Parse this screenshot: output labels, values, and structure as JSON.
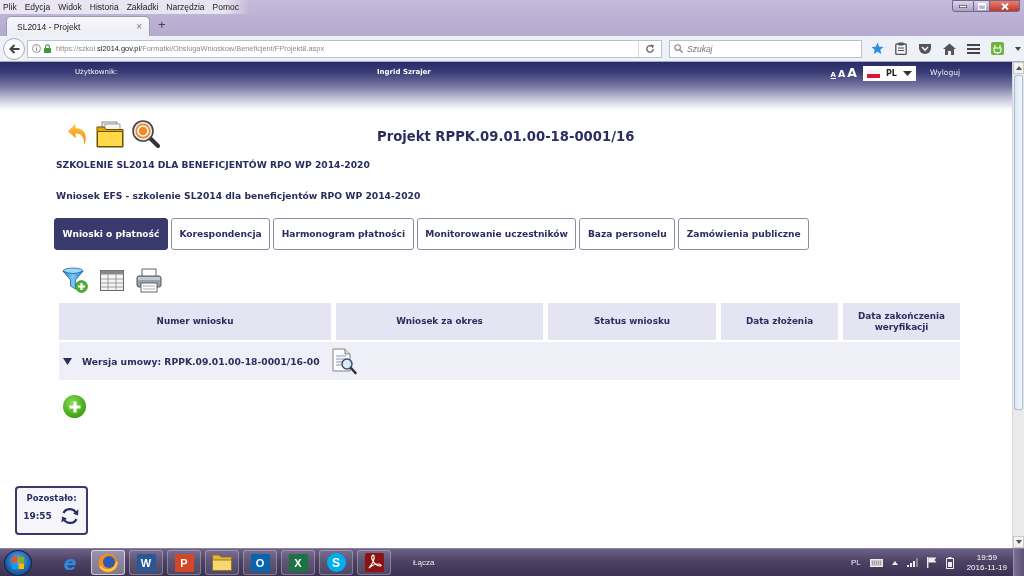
{
  "browser": {
    "menu": [
      "Plik",
      "Edycja",
      "Widok",
      "Historia",
      "Zakładki",
      "Narzędzia",
      "Pomoc"
    ],
    "tab": {
      "title": "SL2014 - Projekt",
      "close": "×"
    },
    "new_tab": "+",
    "url": "https://szkol.**sl2014.gov.pl**/Formatki/ObslugaWnioskow/Beneficjent/FProjekt8.aspx",
    "search": {
      "placeholder": "Szukaj"
    }
  },
  "header": {
    "user_label": "Użytkownik:",
    "user_name": "Ingrid Szrajer",
    "text_sizes": [
      {
        "label": "A",
        "selected": true
      },
      {
        "label": "A",
        "selected": false
      },
      {
        "label": "A",
        "selected": false
      }
    ],
    "language": "PL",
    "logout": "Wyloguj"
  },
  "project": {
    "title": "Projekt RPPK.09.01.00-18-0001/16",
    "program": "SZKOLENIE SL2014 DLA BENEFICJENTÓW RPO WP 2014-2020",
    "application": "Wniosek EFS - szkolenie SL2014 dla beneficjentów RPO WP 2014-2020"
  },
  "tabs": [
    {
      "label": "Wnioski o płatność",
      "selected": true
    },
    {
      "label": "Korespondencja",
      "selected": false
    },
    {
      "label": "Harmonogram płatności",
      "selected": false
    },
    {
      "label": "Monitorowanie uczestników",
      "selected": false
    },
    {
      "label": "Baza personelu",
      "selected": false
    },
    {
      "label": "Zamówienia publiczne",
      "selected": false
    }
  ],
  "table": {
    "columns": [
      "Numer wniosku",
      "Wniosek za okres",
      "Status wniosku",
      "Data złożenia",
      "Data zakończenia weryfikacji"
    ],
    "groups": [
      {
        "label": "Wersja umowy: RPPK.09.01.00-18-0001/16-00",
        "expanded": true
      }
    ]
  },
  "session": {
    "label": "Pozostało:",
    "time": "19:55"
  },
  "taskbar": {
    "apps": [
      {
        "kind": "orbit",
        "glyph": "e",
        "running": false,
        "selected": false
      },
      {
        "kind": "globe",
        "running": true,
        "selected": true
      },
      {
        "kind": "tile",
        "glyph": "W",
        "color": "#2b5797",
        "running": true,
        "selected": false
      },
      {
        "kind": "tile",
        "glyph": "P",
        "color": "#d24726",
        "running": true,
        "selected": false
      },
      {
        "kind": "folder",
        "running": true,
        "selected": false
      },
      {
        "kind": "tile",
        "glyph": "O",
        "color": "#0a64ad",
        "running": true,
        "selected": false
      },
      {
        "kind": "tile",
        "glyph": "X",
        "color": "#1e7145",
        "running": true,
        "selected": false
      },
      {
        "kind": "bubble",
        "glyph": "S",
        "color": "#00aff0",
        "running": true,
        "selected": false
      },
      {
        "kind": "ribbon",
        "running": true,
        "selected": false
      }
    ],
    "links_label": "Łącza",
    "tray": {
      "language": "PL",
      "time": "19:59",
      "date": "2016-11-19"
    }
  }
}
